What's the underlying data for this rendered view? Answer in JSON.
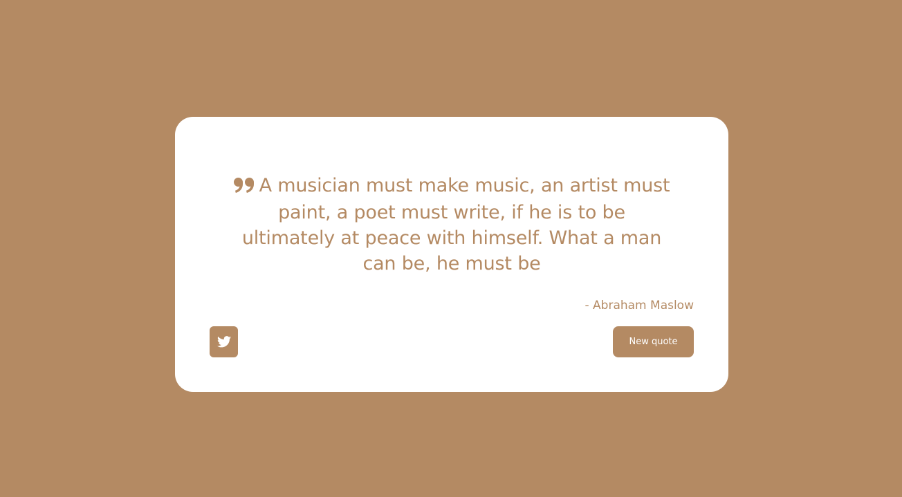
{
  "theme": {
    "accent_color": "#b48a63",
    "card_color": "#ffffff"
  },
  "quote": {
    "icon": "quote-left-icon",
    "text": "A musician must make music, an artist must paint, a poet must write, if he is to be ultimately at peace with himself. What a man can be, he must be",
    "author": "- Abraham Maslow"
  },
  "actions": {
    "tweet_icon": "twitter-icon",
    "new_quote_label": "New quote"
  }
}
